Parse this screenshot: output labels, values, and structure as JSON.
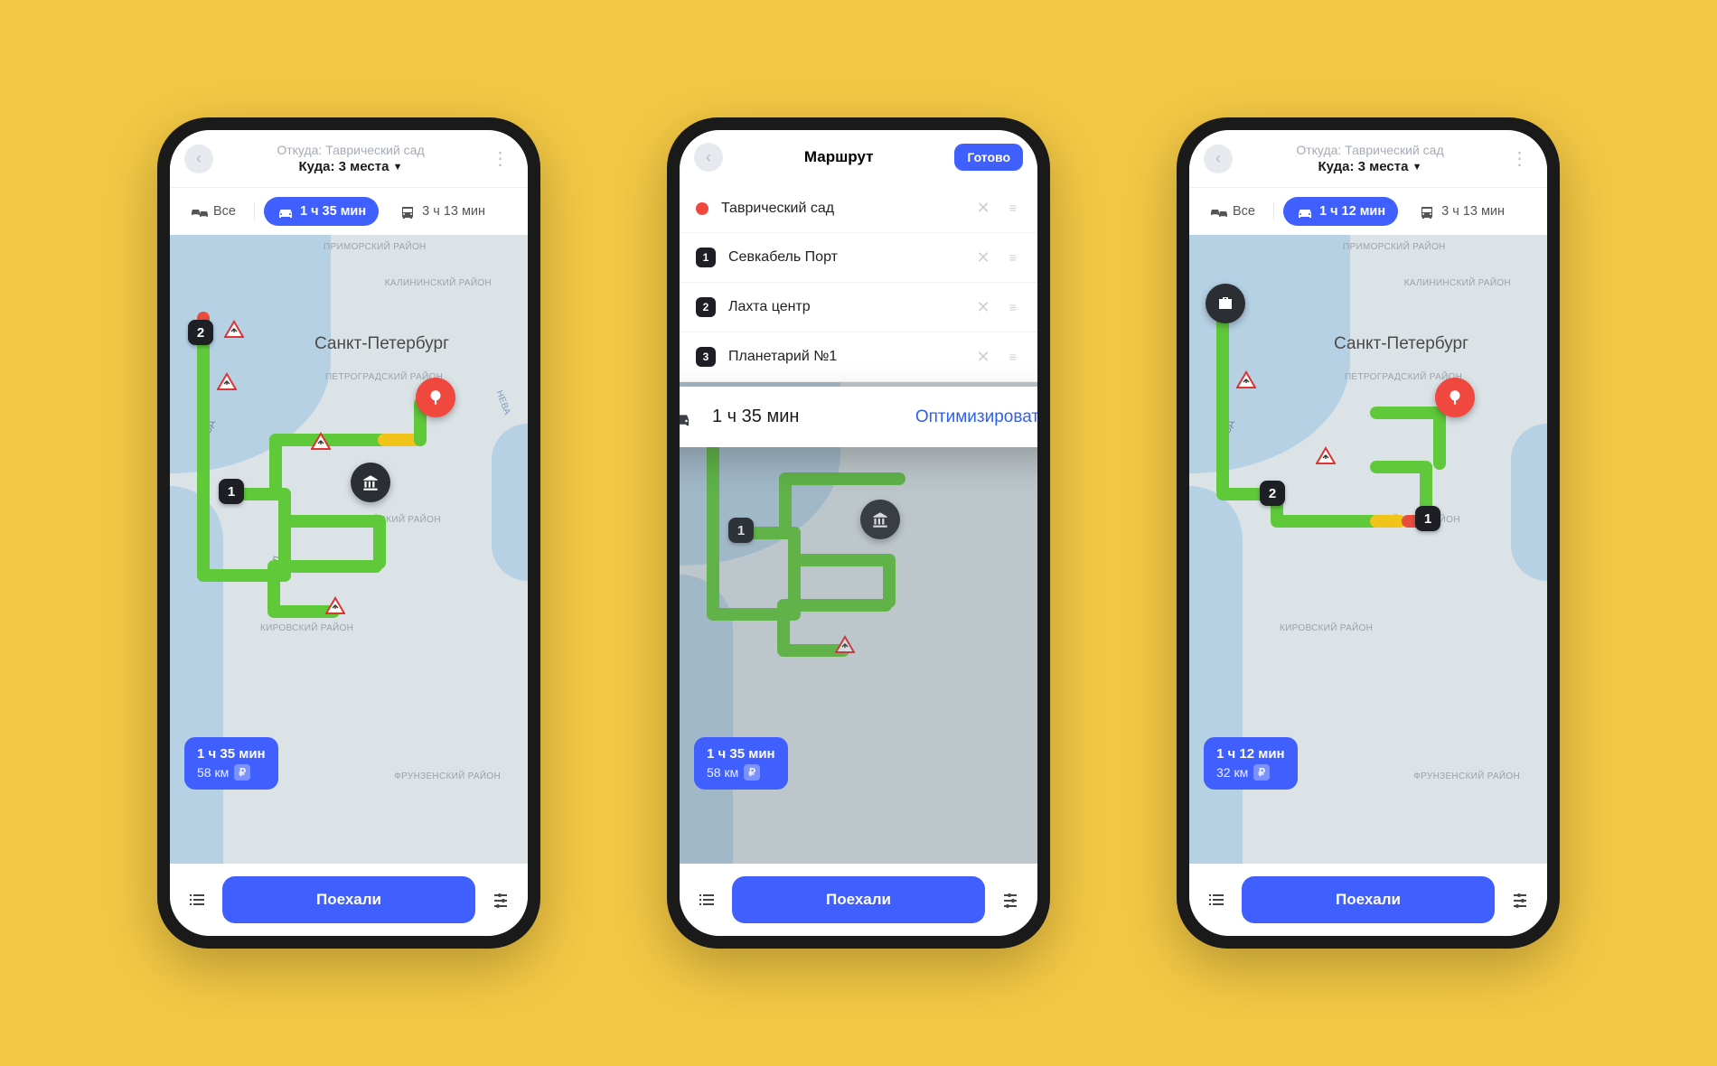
{
  "accent": "#3f5fff",
  "phones": {
    "p1": {
      "from_label": "Откуда: Таврический сад",
      "to_label": "Куда: 3 места",
      "tab_all": "Все",
      "tab_car": "1 ч 35 мин",
      "tab_bus": "3 ч 13 мин",
      "city": "Санкт-Петербург",
      "districts": {
        "primorsky": "ПРИМОРСКИЙ РАЙОН",
        "kalininsky": "КАЛИНИНСКИЙ РАЙОН",
        "petrogradsky": "ПЕТРОГРАДСКИЙ РАЙОН",
        "admiralteysky": "АДМИРАЛТЕЙСКИЙ РАЙОН",
        "kirovsky": "КИРОВСКИЙ РАЙОН",
        "frunzensky": "ФРУНЗЕНСКИЙ РАЙОН"
      },
      "zsd": "ЗСД",
      "neva": "Нева",
      "pin1": "1",
      "pin2": "2",
      "summary_time": "1 ч 35 мин",
      "summary_dist": "58 км",
      "paid": "₽",
      "go": "Поехали"
    },
    "p2": {
      "title": "Маршрут",
      "done": "Готово",
      "stops": [
        {
          "label": "Таврический сад",
          "badge": ""
        },
        {
          "label": "Севкабель Порт",
          "badge": "1"
        },
        {
          "label": "Лахта центр",
          "badge": "2"
        },
        {
          "label": "Планетарий №1",
          "badge": "3"
        }
      ],
      "opt_time": "1 ч 35 мин",
      "opt_link": "Оптимизировать",
      "pin1": "1",
      "summary_time": "1 ч 35 мин",
      "summary_dist": "58 км",
      "paid": "₽",
      "go": "Поехали"
    },
    "p3": {
      "from_label": "Откуда: Таврический сад",
      "to_label": "Куда: 3 места",
      "tab_all": "Все",
      "tab_car": "1 ч 12 мин",
      "tab_bus": "3 ч 13 мин",
      "city": "Санкт-Петербург",
      "pin1": "1",
      "pin2": "2",
      "summary_time": "1 ч 12 мин",
      "summary_dist": "32 км",
      "paid": "₽",
      "go": "Поехали"
    }
  }
}
